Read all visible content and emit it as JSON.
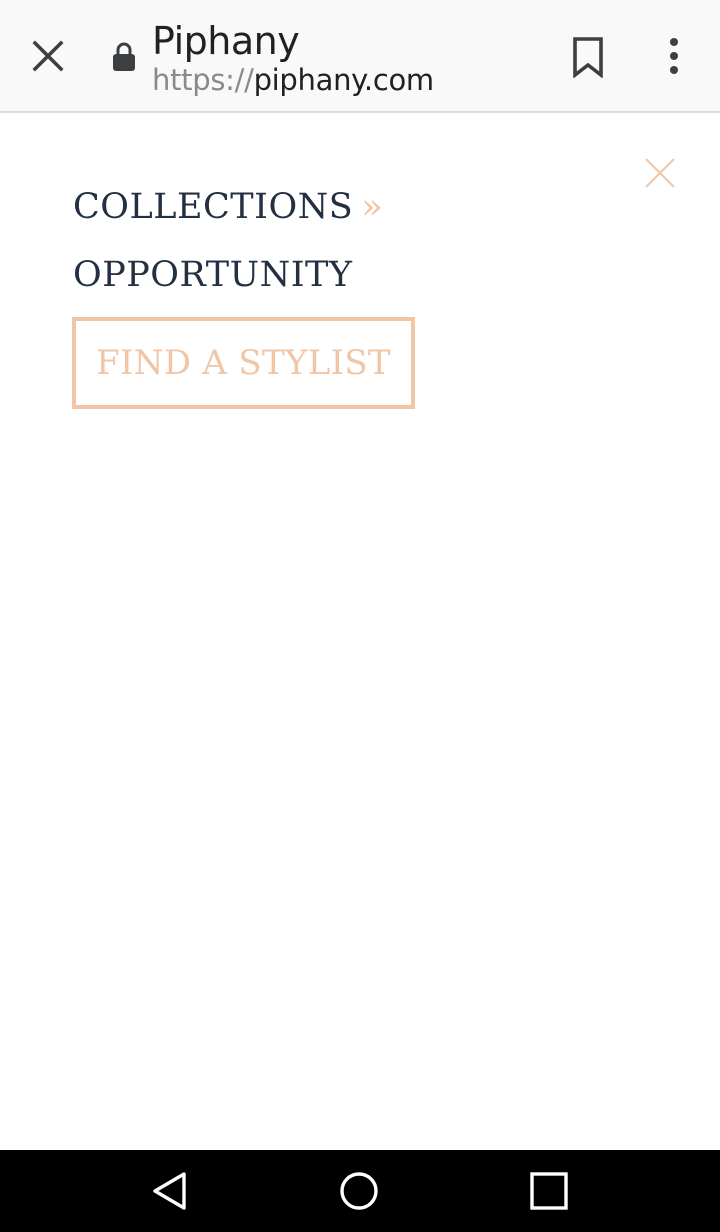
{
  "browser": {
    "title": "Piphany",
    "url_scheme": "https://",
    "url_host": "piphany.com",
    "icons": {
      "close": "close-icon",
      "lock": "lock-icon",
      "bookmark": "bookmark-icon",
      "menu": "more-vert-icon"
    }
  },
  "menu": {
    "items": [
      {
        "label": "COLLECTIONS",
        "suffix": "»"
      },
      {
        "label": "OPPORTUNITY"
      }
    ],
    "cta_label": "FIND A STYLIST",
    "close_icon": "close-icon"
  },
  "android_nav": {
    "icons": [
      "back-icon",
      "home-icon",
      "recents-icon"
    ]
  },
  "colors": {
    "nav_text": "#233042",
    "accent": "#f0c6a6",
    "topbar_bg": "#f9f9f9"
  }
}
